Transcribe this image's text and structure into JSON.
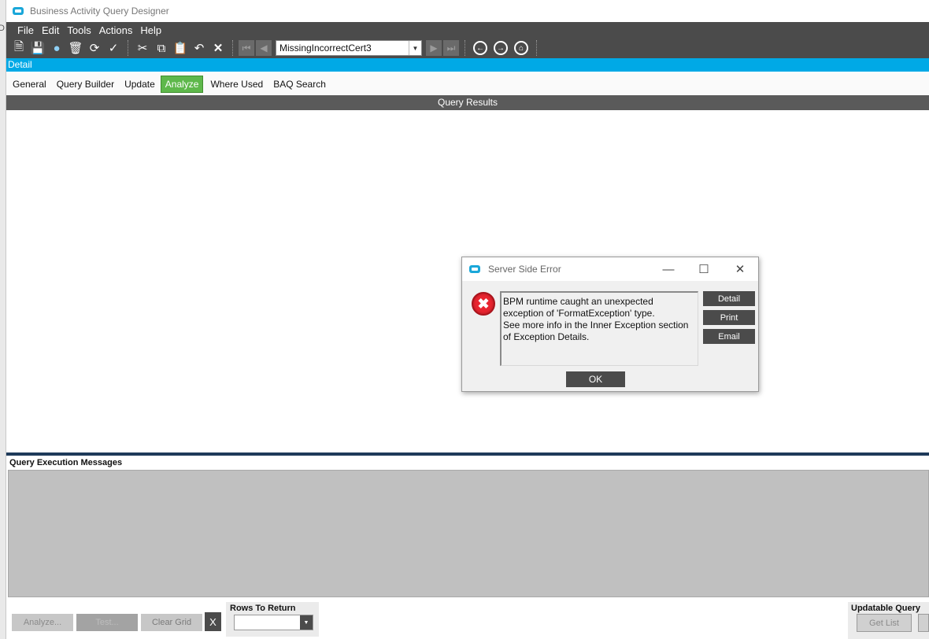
{
  "window": {
    "title": "Business Activity Query Designer"
  },
  "menubar": {
    "items": [
      "File",
      "Edit",
      "Tools",
      "Actions",
      "Help"
    ]
  },
  "toolbar": {
    "record_selector_value": "MissingIncorrectCert3"
  },
  "detail_bar": {
    "label": "Detail"
  },
  "tabs": {
    "items": [
      "General",
      "Query Builder",
      "Update",
      "Analyze",
      "Where Used",
      "BAQ Search"
    ],
    "active": "Analyze"
  },
  "query_results": {
    "header": "Query Results"
  },
  "execution_messages": {
    "label": "Query Execution Messages"
  },
  "bottom": {
    "analyze_label": "Analyze...",
    "test_label": "Test...",
    "clear_grid_label": "Clear Grid",
    "close_label": "X",
    "rows_to_return_label": "Rows To Return",
    "rows_to_return_value": "",
    "updatable_query_label": "Updatable Query",
    "get_list_label": "Get List"
  },
  "dialog": {
    "title": "Server Side Error",
    "message": "BPM runtime caught an unexpected exception of 'FormatException' type.\nSee more info in the Inner Exception section of Exception Details.",
    "detail_label": "Detail",
    "print_label": "Print",
    "email_label": "Email",
    "ok_label": "OK"
  },
  "colors": {
    "accent": "#00a9e6",
    "toolbar": "#4b4b4b",
    "active_tab": "#5eb84b",
    "error_icon": "#e8242f"
  }
}
